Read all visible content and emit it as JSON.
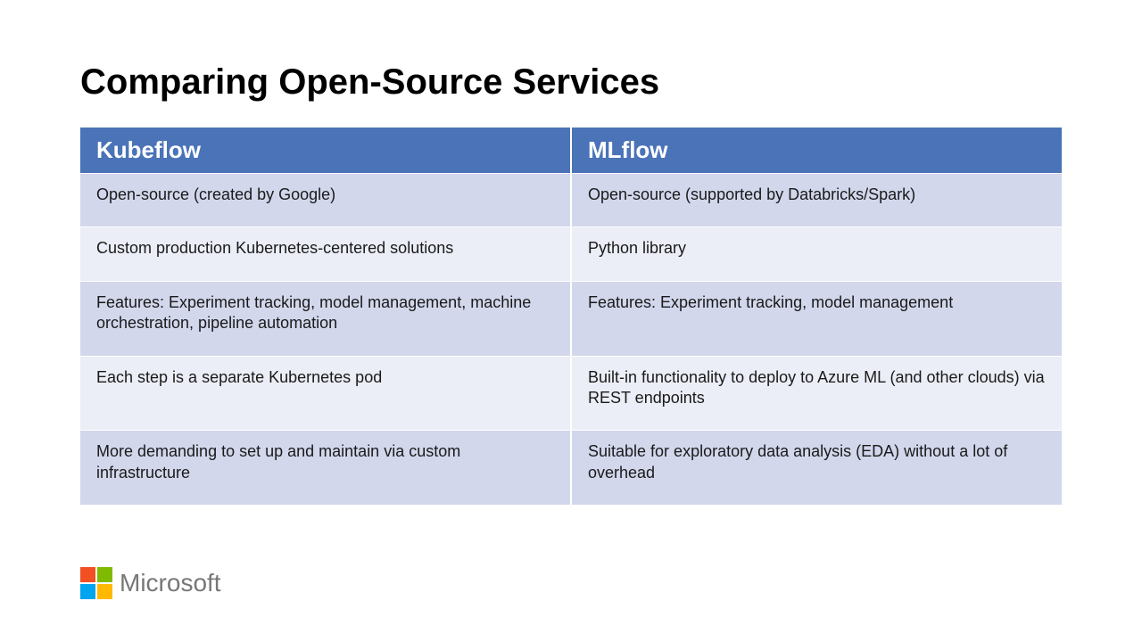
{
  "title": "Comparing Open-Source Services",
  "table": {
    "headers": [
      "Kubeflow",
      "MLflow"
    ],
    "rows": [
      [
        "Open-source (created by Google)",
        "Open-source (supported by Databricks/Spark)"
      ],
      [
        "Custom production Kubernetes-centered solutions",
        "Python library"
      ],
      [
        "Features: Experiment tracking, model management, machine orchestration, pipeline automation",
        "Features: Experiment tracking, model management"
      ],
      [
        "Each step is a separate Kubernetes pod",
        "Built-in functionality to deploy to Azure ML (and other clouds) via REST endpoints"
      ],
      [
        "More demanding to set up and maintain via custom infrastructure",
        "Suitable for exploratory data analysis (EDA) without a lot of overhead"
      ]
    ]
  },
  "footer": {
    "brand": "Microsoft"
  }
}
